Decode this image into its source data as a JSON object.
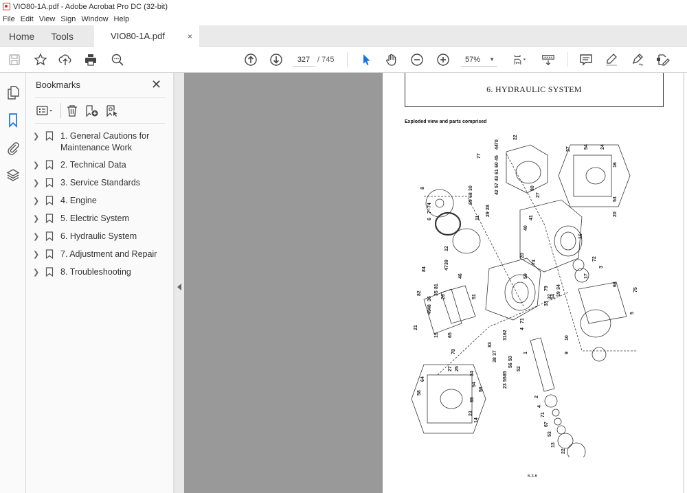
{
  "window": {
    "title": "VIO80-1A.pdf - Adobe Acrobat Pro DC (32-bit)",
    "menu": [
      "File",
      "Edit",
      "View",
      "Sign",
      "Window",
      "Help"
    ]
  },
  "tabs": {
    "home": "Home",
    "tools": "Tools",
    "document": "VIO80-1A.pdf",
    "close_glyph": "×"
  },
  "toolbar": {
    "left_icons": [
      "save-icon",
      "star-icon",
      "cloud-upload-icon",
      "print-icon",
      "search-zoom-icon"
    ],
    "nav_icons": [
      "page-up-icon",
      "page-down-icon"
    ],
    "current_page": "327",
    "total_pages": "/ 745",
    "tool_icons": [
      "select-cursor-icon",
      "hand-icon",
      "zoom-out-icon",
      "zoom-in-icon"
    ],
    "zoom_level": "57%",
    "view_icons": [
      "fit-page-icon",
      "scroll-mode-icon"
    ],
    "right_icons": [
      "comment-icon",
      "highlight-icon",
      "sign-icon",
      "fill-sign-icon"
    ],
    "accent_color": "#1473e6"
  },
  "left_rail": {
    "icons": [
      "pages-icon",
      "bookmarks-icon",
      "attachments-icon",
      "layers-icon"
    ],
    "active": "bookmarks-icon"
  },
  "bookmarks": {
    "title": "Bookmarks",
    "close_glyph": "✕",
    "tools": [
      "options-icon",
      "delete-icon",
      "new-bookmark-icon",
      "bookmark-from-structure-icon"
    ],
    "items": [
      {
        "label": "1. General Cautions for Maintenance Work"
      },
      {
        "label": "2. Technical Data"
      },
      {
        "label": "3. Service Standards"
      },
      {
        "label": "4. Engine"
      },
      {
        "label": "5. Electric System"
      },
      {
        "label": "6. Hydraulic System"
      },
      {
        "label": "7. Adjustment and Repair"
      },
      {
        "label": "8. Troubleshooting"
      }
    ]
  },
  "document": {
    "header": "6. HYDRAULIC SYSTEM",
    "subtitle": "Exploded view and parts comprised",
    "page_number": "6-3-6",
    "callouts": [
      "22",
      "70",
      "44",
      "77",
      "45",
      "60",
      "61",
      "43",
      "57",
      "42",
      "8",
      "30",
      "68",
      "69",
      "7~74",
      "6",
      "28",
      "29",
      "11",
      "12",
      "39",
      "47",
      "84",
      "46",
      "81",
      "35",
      "26",
      "82",
      "36",
      "48",
      "49",
      "51",
      "14",
      "27",
      "54",
      "24",
      "16",
      "53",
      "80",
      "27",
      "20",
      "41",
      "40",
      "20",
      "73",
      "59",
      "16",
      "72",
      "3",
      "17",
      "75",
      "66",
      "5",
      "10",
      "9",
      "34",
      "19",
      "79",
      "32",
      "33",
      "71",
      "4",
      "62",
      "31",
      "83",
      "37",
      "38",
      "50",
      "56",
      "52",
      "85",
      "55",
      "23",
      "1",
      "2",
      "4",
      "71",
      "67",
      "53",
      "13",
      "22",
      "21",
      "15",
      "65",
      "78",
      "64",
      "58",
      "27",
      "25",
      "34",
      "54",
      "55",
      "23",
      "14",
      "58"
    ]
  }
}
